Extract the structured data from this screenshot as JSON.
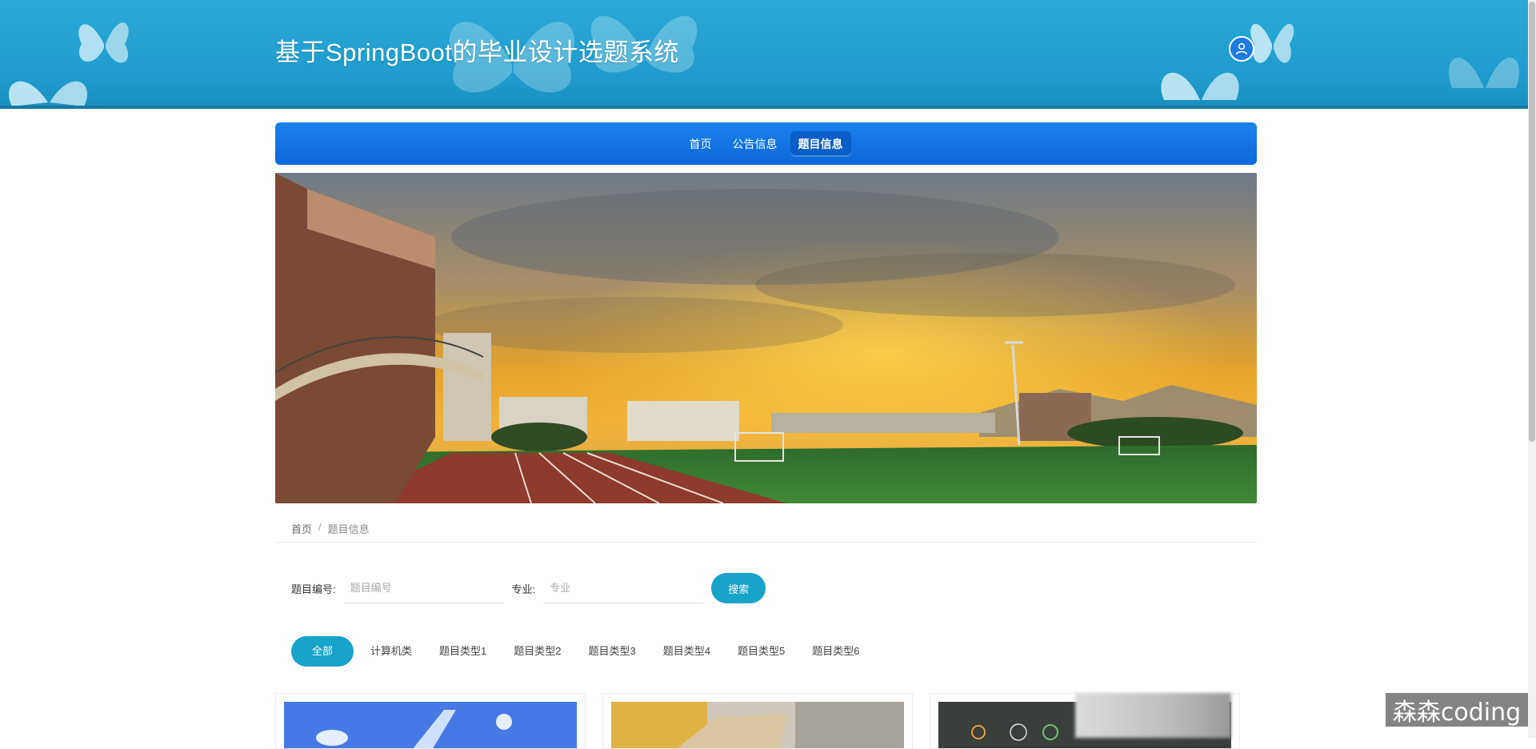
{
  "header": {
    "site_title": "基于SpringBoot的毕业设计选题系统",
    "user_icon": "user-icon"
  },
  "nav": {
    "items": [
      {
        "label": "首页",
        "active": false
      },
      {
        "label": "公告信息",
        "active": false
      },
      {
        "label": "题目信息",
        "active": true
      }
    ]
  },
  "banner": {
    "description": "sports-field-sunset-photo"
  },
  "breadcrumb": {
    "home": "首页",
    "separator": "/",
    "current": "题目信息"
  },
  "search": {
    "topic_no_label": "题目编号:",
    "topic_no_placeholder": "题目编号",
    "major_label": "专业:",
    "major_placeholder": "专业",
    "button_label": "搜索"
  },
  "categories": [
    {
      "label": "全部",
      "active": true
    },
    {
      "label": "计算机类",
      "active": false
    },
    {
      "label": "题目类型1",
      "active": false
    },
    {
      "label": "题目类型2",
      "active": false
    },
    {
      "label": "题目类型3",
      "active": false
    },
    {
      "label": "题目类型4",
      "active": false
    },
    {
      "label": "题目类型5",
      "active": false
    },
    {
      "label": "题目类型6",
      "active": false
    }
  ],
  "watermark": "森森coding",
  "colors": {
    "header_bg": "#1f9ccd",
    "nav_bg": "#0c67d8",
    "accent": "#18a3c9"
  }
}
